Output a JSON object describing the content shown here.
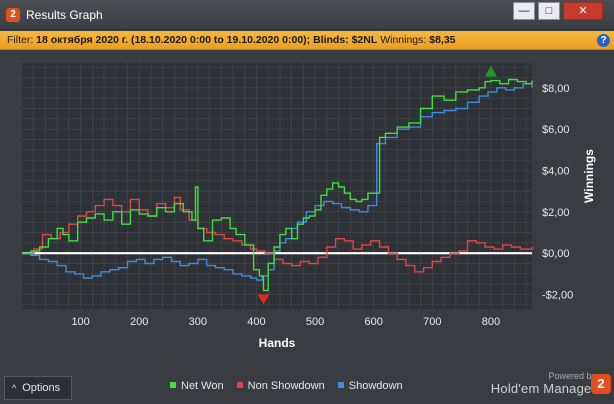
{
  "window": {
    "app_icon_label": "2",
    "title": "Results Graph",
    "minimize": "—",
    "maximize": "□",
    "close": "✕"
  },
  "filter": {
    "prefix": "Filter:",
    "date_range": "18 октября 2020 г. (18.10.2020 0:00 to 19.10.2020 0:00);",
    "blinds_label": "Blinds:",
    "blinds_value": "$2NL",
    "winnings_label": "Winnings:",
    "winnings_value": "$8,35",
    "help_icon": "?"
  },
  "options": {
    "caret": "^",
    "label": "Options"
  },
  "brand": {
    "powered_by": "Powered by",
    "name": "Hold'em Manager",
    "logo": "2"
  },
  "colors": {
    "net_won": "#3fe03f",
    "non_showdown": "#e04848",
    "showdown": "#3d8ee0",
    "zero_line": "#ffffff",
    "grid": "#5a5d62",
    "plot_bg": "#2e3135",
    "max_marker": "#1f9a2a",
    "min_marker": "#e02a1a"
  },
  "chart_data": {
    "type": "line",
    "xlabel": "Hands",
    "ylabel": "Winnings",
    "xlim": [
      0,
      870
    ],
    "ylim": [
      -2.7,
      9.2
    ],
    "x_ticks": [
      100,
      200,
      300,
      400,
      500,
      600,
      700,
      800
    ],
    "y_ticks": [
      -2,
      0,
      2,
      4,
      6,
      8
    ],
    "y_tick_labels": [
      "-$2,00",
      "$0,00",
      "$2,00",
      "$4,00",
      "$6,00",
      "$8,00"
    ],
    "grid": true,
    "legend_position": "bottom",
    "series": [
      {
        "name": "Net Won",
        "color_key": "net_won",
        "points": [
          [
            0,
            0
          ],
          [
            15,
            0.1
          ],
          [
            30,
            0.3
          ],
          [
            45,
            0.7
          ],
          [
            60,
            1.2
          ],
          [
            70,
            0.9
          ],
          [
            80,
            0.6
          ],
          [
            95,
            1.5
          ],
          [
            110,
            1.7
          ],
          [
            125,
            1.9
          ],
          [
            140,
            1.6
          ],
          [
            155,
            2.0
          ],
          [
            170,
            1.4
          ],
          [
            185,
            2.1
          ],
          [
            200,
            1.9
          ],
          [
            215,
            1.8
          ],
          [
            230,
            2.2
          ],
          [
            245,
            2.0
          ],
          [
            260,
            2.4
          ],
          [
            275,
            2.0
          ],
          [
            290,
            1.6
          ],
          [
            296,
            3.2
          ],
          [
            300,
            1.2
          ],
          [
            310,
            0.6
          ],
          [
            325,
            1.6
          ],
          [
            340,
            1.7
          ],
          [
            355,
            1.2
          ],
          [
            365,
            0.9
          ],
          [
            380,
            0.4
          ],
          [
            395,
            -0.8
          ],
          [
            405,
            -1.1
          ],
          [
            412,
            -1.8
          ],
          [
            420,
            -0.5
          ],
          [
            430,
            0.3
          ],
          [
            440,
            0.9
          ],
          [
            450,
            1.2
          ],
          [
            460,
            0.7
          ],
          [
            470,
            1.4
          ],
          [
            480,
            1.7
          ],
          [
            490,
            1.8
          ],
          [
            500,
            2.1
          ],
          [
            510,
            2.8
          ],
          [
            520,
            3.1
          ],
          [
            530,
            3.4
          ],
          [
            540,
            3.2
          ],
          [
            550,
            2.9
          ],
          [
            560,
            2.6
          ],
          [
            570,
            2.5
          ],
          [
            580,
            2.6
          ],
          [
            590,
            2.9
          ],
          [
            610,
            5.6
          ],
          [
            620,
            5.8
          ],
          [
            640,
            6.1
          ],
          [
            660,
            6.3
          ],
          [
            680,
            7.0
          ],
          [
            700,
            7.6
          ],
          [
            720,
            7.4
          ],
          [
            740,
            7.8
          ],
          [
            760,
            7.9
          ],
          [
            780,
            8.0
          ],
          [
            790,
            8.3
          ],
          [
            800,
            8.35
          ],
          [
            815,
            8.2
          ],
          [
            830,
            8.4
          ],
          [
            845,
            8.3
          ],
          [
            860,
            8.2
          ],
          [
            870,
            8.35
          ]
        ]
      },
      {
        "name": "Non Showdown",
        "color_key": "non_showdown",
        "points": [
          [
            0,
            0
          ],
          [
            20,
            0.2
          ],
          [
            35,
            0.9
          ],
          [
            50,
            0.7
          ],
          [
            65,
            1.0
          ],
          [
            80,
            1.4
          ],
          [
            95,
            1.8
          ],
          [
            110,
            2.0
          ],
          [
            125,
            2.3
          ],
          [
            140,
            2.6
          ],
          [
            155,
            2.3
          ],
          [
            170,
            2.0
          ],
          [
            185,
            2.6
          ],
          [
            200,
            2.1
          ],
          [
            215,
            1.8
          ],
          [
            230,
            2.4
          ],
          [
            245,
            2.2
          ],
          [
            260,
            2.7
          ],
          [
            270,
            2.1
          ],
          [
            285,
            1.6
          ],
          [
            300,
            1.2
          ],
          [
            315,
            1.0
          ],
          [
            330,
            0.9
          ],
          [
            345,
            0.7
          ],
          [
            360,
            0.6
          ],
          [
            375,
            0.4
          ],
          [
            390,
            0.2
          ],
          [
            400,
            0.1
          ],
          [
            415,
            0.0
          ],
          [
            430,
            -0.3
          ],
          [
            445,
            -0.5
          ],
          [
            460,
            -0.6
          ],
          [
            475,
            -0.4
          ],
          [
            490,
            -0.5
          ],
          [
            505,
            -0.2
          ],
          [
            520,
            0.3
          ],
          [
            535,
            0.7
          ],
          [
            550,
            0.6
          ],
          [
            565,
            0.2
          ],
          [
            580,
            0.4
          ],
          [
            595,
            0.6
          ],
          [
            610,
            0.3
          ],
          [
            625,
            0.0
          ],
          [
            640,
            -0.3
          ],
          [
            655,
            -0.6
          ],
          [
            670,
            -0.9
          ],
          [
            685,
            -0.7
          ],
          [
            700,
            -0.4
          ],
          [
            715,
            -0.2
          ],
          [
            730,
            0.0
          ],
          [
            745,
            0.1
          ],
          [
            760,
            0.6
          ],
          [
            775,
            0.5
          ],
          [
            790,
            0.3
          ],
          [
            805,
            0.2
          ],
          [
            820,
            0.4
          ],
          [
            835,
            0.3
          ],
          [
            850,
            0.2
          ],
          [
            870,
            0.3
          ]
        ]
      },
      {
        "name": "Showdown",
        "color_key": "showdown",
        "points": [
          [
            0,
            0
          ],
          [
            15,
            -0.1
          ],
          [
            30,
            -0.3
          ],
          [
            45,
            -0.4
          ],
          [
            60,
            -0.6
          ],
          [
            75,
            -0.9
          ],
          [
            90,
            -1.0
          ],
          [
            105,
            -1.2
          ],
          [
            120,
            -1.1
          ],
          [
            135,
            -0.9
          ],
          [
            150,
            -0.8
          ],
          [
            165,
            -0.7
          ],
          [
            180,
            -0.4
          ],
          [
            195,
            -0.3
          ],
          [
            210,
            -0.5
          ],
          [
            225,
            -0.3
          ],
          [
            240,
            -0.2
          ],
          [
            255,
            -0.4
          ],
          [
            270,
            -0.6
          ],
          [
            285,
            -0.5
          ],
          [
            300,
            -0.3
          ],
          [
            315,
            -0.6
          ],
          [
            330,
            -0.7
          ],
          [
            345,
            -0.8
          ],
          [
            360,
            -1.0
          ],
          [
            375,
            -1.1
          ],
          [
            390,
            -1.2
          ],
          [
            400,
            -1.3
          ],
          [
            410,
            -1.1
          ],
          [
            420,
            -0.8
          ],
          [
            430,
            0.1
          ],
          [
            440,
            0.5
          ],
          [
            450,
            0.7
          ],
          [
            460,
            1.2
          ],
          [
            470,
            1.5
          ],
          [
            485,
            2.0
          ],
          [
            500,
            2.3
          ],
          [
            515,
            2.5
          ],
          [
            530,
            2.4
          ],
          [
            545,
            2.2
          ],
          [
            560,
            2.1
          ],
          [
            575,
            2.0
          ],
          [
            590,
            2.3
          ],
          [
            605,
            5.3
          ],
          [
            620,
            5.6
          ],
          [
            640,
            6.0
          ],
          [
            660,
            6.1
          ],
          [
            680,
            6.6
          ],
          [
            700,
            6.8
          ],
          [
            720,
            6.9
          ],
          [
            740,
            7.0
          ],
          [
            760,
            7.3
          ],
          [
            780,
            7.6
          ],
          [
            795,
            7.8
          ],
          [
            810,
            8.0
          ],
          [
            825,
            7.9
          ],
          [
            840,
            8.0
          ],
          [
            855,
            8.2
          ],
          [
            870,
            8.0
          ]
        ]
      }
    ],
    "max_marker": {
      "x": 800,
      "y": 8.35
    },
    "min_marker": {
      "x": 412,
      "y": -1.8
    }
  }
}
